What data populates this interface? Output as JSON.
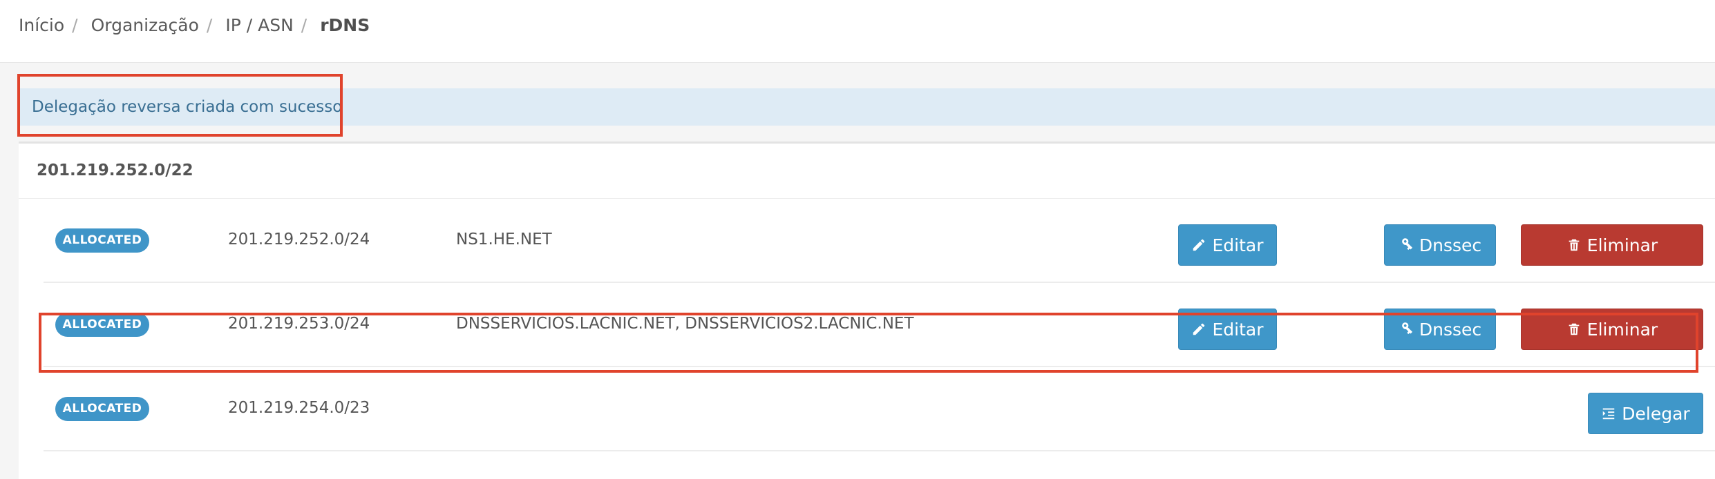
{
  "breadcrumb": {
    "items": [
      "Início",
      "Organização",
      "IP / ASN"
    ],
    "active": "rDNS",
    "separator": "/"
  },
  "alert": {
    "message": "Delegação reversa criada com sucesso"
  },
  "panel": {
    "title": "201.219.252.0/22",
    "rows": [
      {
        "status": "ALLOCATED",
        "prefix": "201.219.252.0/24",
        "nameservers": "NS1.HE.NET",
        "edit_label": "Editar",
        "dnssec_label": "Dnssec",
        "delete_label": "Eliminar"
      },
      {
        "status": "ALLOCATED",
        "prefix": "201.219.253.0/24",
        "nameservers": "DNSSERVICIOS.LACNIC.NET, DNSSERVICIOS2.LACNIC.NET",
        "edit_label": "Editar",
        "dnssec_label": "Dnssec",
        "delete_label": "Eliminar"
      },
      {
        "status": "ALLOCATED",
        "prefix": "201.219.254.0/23",
        "delegate_label": "Delegar"
      }
    ]
  },
  "colors": {
    "badge": "#3f95c8",
    "primary_button": "#3f97c9",
    "danger_button": "#b93a31",
    "alert_bg": "#deebf5",
    "highlight": "#e0432c"
  }
}
